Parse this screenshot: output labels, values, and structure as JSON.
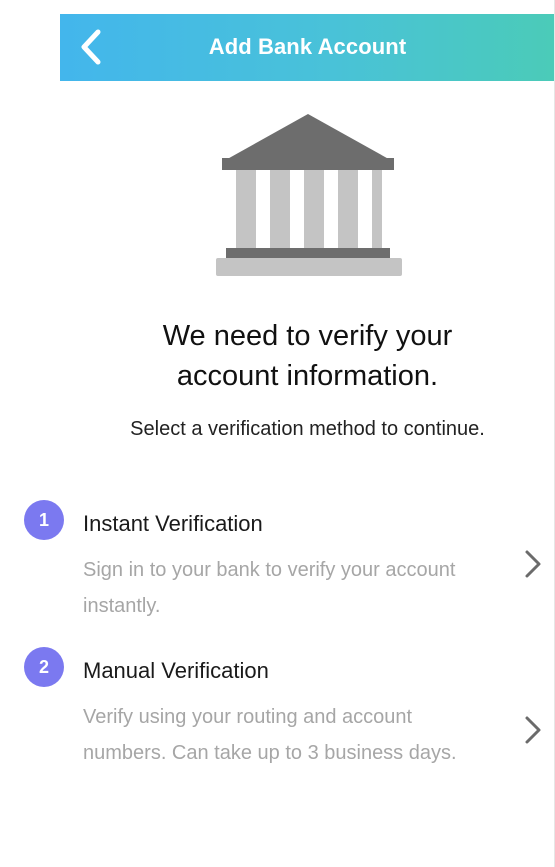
{
  "header": {
    "title": "Add Bank Account",
    "back_icon": "chevron-left-icon",
    "gradient_start": "#43b6ec",
    "gradient_end": "#4bcbb8"
  },
  "illustration": {
    "icon": "bank-building-icon"
  },
  "headline": {
    "line1": "We need to verify your",
    "line2": "account information."
  },
  "subtitle": "Select a verification method to continue.",
  "options": [
    {
      "step": "1",
      "title": "Instant Verification",
      "description": "Sign in to your bank to verify your account instantly.",
      "icon": "chevron-right-icon"
    },
    {
      "step": "2",
      "title": "Manual Verification",
      "description": "Verify using your routing and account numbers. Can take up to 3 business days.",
      "icon": "chevron-right-icon"
    }
  ],
  "colors": {
    "badge": "#7b79f0",
    "title_text": "#1a1a1a",
    "description_text": "#a6a6a6",
    "chevron": "#6b6b6b"
  }
}
